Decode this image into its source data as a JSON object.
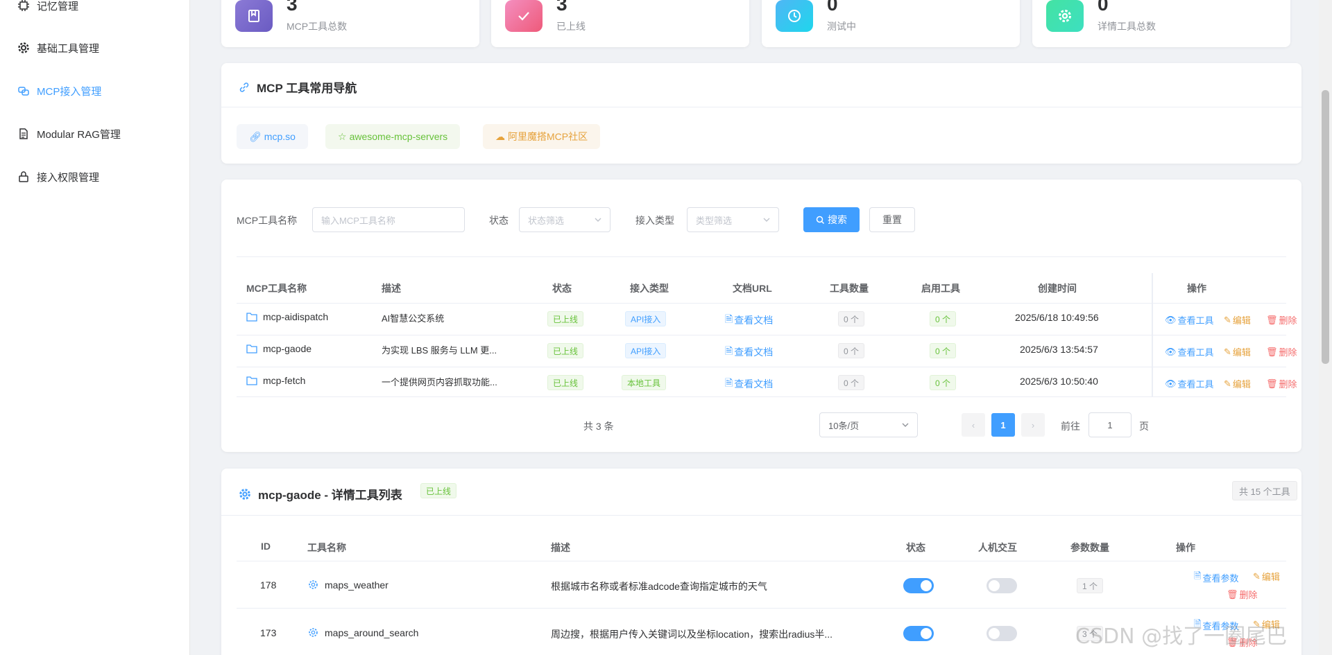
{
  "sidebar": {
    "items": [
      {
        "label": "记忆管理",
        "icon": "chip-icon"
      },
      {
        "label": "基础工具管理",
        "icon": "gear-icon"
      },
      {
        "label": "MCP接入管理",
        "icon": "link-icon"
      },
      {
        "label": "Modular RAG管理",
        "icon": "document-icon"
      },
      {
        "label": "接入权限管理",
        "icon": "lock-icon"
      }
    ],
    "active_index": 2
  },
  "stats": [
    {
      "value": "3",
      "label": "MCP工具总数",
      "icon": "book-icon",
      "color": "#7b68c9"
    },
    {
      "value": "3",
      "label": "已上线",
      "icon": "check-icon",
      "color": "#f06b9a"
    },
    {
      "value": "0",
      "label": "测试中",
      "icon": "clock-icon",
      "color": "#2fc6f2"
    },
    {
      "value": "0",
      "label": "详情工具总数",
      "icon": "gear-icon",
      "color": "#35e0a1"
    }
  ],
  "nav_section": {
    "title": "MCP 工具常用导航",
    "links": [
      {
        "label": "mcp.so",
        "icon": "link-icon",
        "color": "#409eff"
      },
      {
        "label": "awesome-mcp-servers",
        "icon": "star-icon",
        "color": "#67c23a"
      },
      {
        "label": "阿里魔搭MCP社区",
        "icon": "cloud-icon",
        "color": "#e6a23c"
      }
    ]
  },
  "filter": {
    "name_label": "MCP工具名称",
    "name_placeholder": "输入MCP工具名称",
    "status_label": "状态",
    "status_placeholder": "状态筛选",
    "type_label": "接入类型",
    "type_placeholder": "类型筛选",
    "search_button": "搜索",
    "reset_button": "重置"
  },
  "mcp_table": {
    "headers": [
      "MCP工具名称",
      "描述",
      "状态",
      "接入类型",
      "文档URL",
      "工具数量",
      "启用工具",
      "创建时间",
      "操作"
    ],
    "rows": [
      {
        "name": "mcp-aidispatch",
        "desc": "AI智慧公交系统",
        "status": "已上线",
        "type": "API接入",
        "type_style": "blue",
        "doc": "查看文档",
        "tool_count": "0 个",
        "enabled": "0 个",
        "created": "2025/6/18 10:49:56"
      },
      {
        "name": "mcp-gaode",
        "desc": "为实现 LBS 服务与 LLM 更...",
        "status": "已上线",
        "type": "API接入",
        "type_style": "blue",
        "doc": "查看文档",
        "tool_count": "0 个",
        "enabled": "0 个",
        "created": "2025/6/3 13:54:57"
      },
      {
        "name": "mcp-fetch",
        "desc": "一个提供网页内容抓取功能...",
        "status": "已上线",
        "type": "本地工具",
        "type_style": "green",
        "doc": "查看文档",
        "tool_count": "0 个",
        "enabled": "0 个",
        "created": "2025/6/3 10:50:40"
      }
    ],
    "actions": {
      "view": "查看工具",
      "edit": "编辑",
      "delete": "删除"
    }
  },
  "pagination": {
    "total": "共 3 条",
    "page_size": "10条/页",
    "current": "1",
    "goto_label": "前往",
    "goto_value": "1",
    "page_suffix": "页"
  },
  "detail": {
    "title": "mcp-gaode - 详情工具列表",
    "status": "已上线",
    "count": "共 15 个工具",
    "headers": [
      "ID",
      "工具名称",
      "描述",
      "状态",
      "人机交互",
      "参数数量",
      "操作"
    ],
    "rows": [
      {
        "id": "178",
        "name": "maps_weather",
        "desc": "根据城市名称或者标准adcode查询指定城市的天气",
        "enabled": true,
        "interactive": false,
        "params": "1 个"
      },
      {
        "id": "173",
        "name": "maps_around_search",
        "desc": "周边搜，根据用户传入关键词以及坐标location，搜索出radius半...",
        "enabled": true,
        "interactive": false,
        "params": "3 个"
      }
    ],
    "actions": {
      "view_params": "查看参数",
      "edit": "编辑",
      "delete": "删除"
    }
  },
  "watermark": "CSDN @找了一圈尾巴"
}
